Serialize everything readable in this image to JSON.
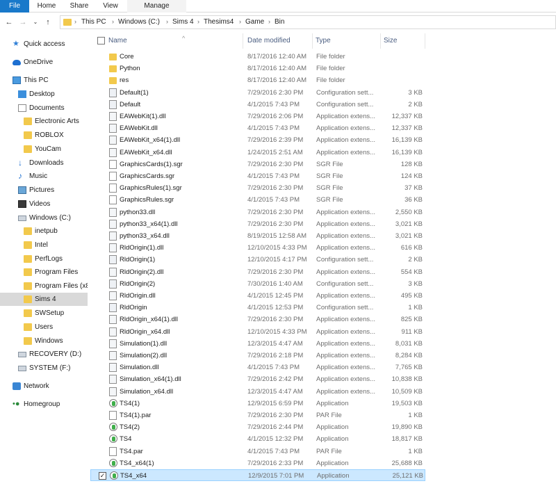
{
  "ribbon": {
    "tabs": [
      "File",
      "Home",
      "Share",
      "View",
      "Manage"
    ]
  },
  "address": {
    "crumbs": [
      "This PC",
      "Windows (C:)",
      "Sims 4",
      "Thesims4",
      "Game",
      "Bin"
    ]
  },
  "nav": {
    "items": [
      {
        "label": "Quick access",
        "icon": "star-icon"
      },
      {
        "label": "OneDrive",
        "icon": "cloud-icon"
      },
      {
        "label": "This PC",
        "icon": "pc-icon"
      },
      {
        "label": "Desktop",
        "icon": "desktop-icon"
      },
      {
        "label": "Documents",
        "icon": "documents-icon"
      },
      {
        "label": "Electronic Arts",
        "icon": "folder-icon"
      },
      {
        "label": "ROBLOX",
        "icon": "folder-icon"
      },
      {
        "label": "YouCam",
        "icon": "folder-icon"
      },
      {
        "label": "Downloads",
        "icon": "download-icon"
      },
      {
        "label": "Music",
        "icon": "music-icon"
      },
      {
        "label": "Pictures",
        "icon": "pictures-icon"
      },
      {
        "label": "Videos",
        "icon": "videos-icon"
      },
      {
        "label": "Windows (C:)",
        "icon": "drive-icon"
      },
      {
        "label": "inetpub",
        "icon": "folder-icon"
      },
      {
        "label": "Intel",
        "icon": "folder-icon"
      },
      {
        "label": "PerfLogs",
        "icon": "folder-icon"
      },
      {
        "label": "Program Files",
        "icon": "folder-icon"
      },
      {
        "label": "Program Files (x86",
        "icon": "folder-icon"
      },
      {
        "label": "Sims 4",
        "icon": "folder-icon"
      },
      {
        "label": "SWSetup",
        "icon": "folder-icon"
      },
      {
        "label": "Users",
        "icon": "folder-icon"
      },
      {
        "label": "Windows",
        "icon": "folder-icon"
      },
      {
        "label": "RECOVERY (D:)",
        "icon": "drive-icon"
      },
      {
        "label": "SYSTEM (F:)",
        "icon": "drive-icon"
      },
      {
        "label": "Network",
        "icon": "network-icon"
      },
      {
        "label": "Homegroup",
        "icon": "homegroup-icon"
      }
    ]
  },
  "columns": {
    "name": "Name",
    "date": "Date modified",
    "type": "Type",
    "size": "Size"
  },
  "files": [
    {
      "name": "Core",
      "date": "8/17/2016 12:40 AM",
      "type": "File folder",
      "size": "",
      "icon": "folder-icon"
    },
    {
      "name": "Python",
      "date": "8/17/2016 12:40 AM",
      "type": "File folder",
      "size": "",
      "icon": "folder-icon"
    },
    {
      "name": "res",
      "date": "8/17/2016 12:40 AM",
      "type": "File folder",
      "size": "",
      "icon": "folder-icon"
    },
    {
      "name": "Default(1)",
      "date": "7/29/2016 2:30 PM",
      "type": "Configuration sett...",
      "size": "3 KB",
      "icon": "config-file-icon"
    },
    {
      "name": "Default",
      "date": "4/1/2015 7:43 PM",
      "type": "Configuration sett...",
      "size": "2 KB",
      "icon": "config-file-icon"
    },
    {
      "name": "EAWebKit(1).dll",
      "date": "7/29/2016 2:06 PM",
      "type": "Application extens...",
      "size": "12,337 KB",
      "icon": "dll-file-icon"
    },
    {
      "name": "EAWebKit.dll",
      "date": "4/1/2015 7:43 PM",
      "type": "Application extens...",
      "size": "12,337 KB",
      "icon": "dll-file-icon"
    },
    {
      "name": "EAWebKit_x64(1).dll",
      "date": "7/29/2016 2:39 PM",
      "type": "Application extens...",
      "size": "16,139 KB",
      "icon": "dll-file-icon"
    },
    {
      "name": "EAWebKit_x64.dll",
      "date": "1/24/2015 2:51 AM",
      "type": "Application extens...",
      "size": "16,139 KB",
      "icon": "dll-file-icon"
    },
    {
      "name": "GraphicsCards(1).sgr",
      "date": "7/29/2016 2:30 PM",
      "type": "SGR File",
      "size": "128 KB",
      "icon": "file-icon"
    },
    {
      "name": "GraphicsCards.sgr",
      "date": "4/1/2015 7:43 PM",
      "type": "SGR File",
      "size": "124 KB",
      "icon": "file-icon"
    },
    {
      "name": "GraphicsRules(1).sgr",
      "date": "7/29/2016 2:30 PM",
      "type": "SGR File",
      "size": "37 KB",
      "icon": "file-icon"
    },
    {
      "name": "GraphicsRules.sgr",
      "date": "4/1/2015 7:43 PM",
      "type": "SGR File",
      "size": "36 KB",
      "icon": "file-icon"
    },
    {
      "name": "python33.dll",
      "date": "7/29/2016 2:30 PM",
      "type": "Application extens...",
      "size": "2,550 KB",
      "icon": "dll-file-icon"
    },
    {
      "name": "python33_x64(1).dll",
      "date": "7/29/2016 2:30 PM",
      "type": "Application extens...",
      "size": "3,021 KB",
      "icon": "dll-file-icon"
    },
    {
      "name": "python33_x64.dll",
      "date": "8/19/2015 12:58 AM",
      "type": "Application extens...",
      "size": "3,021 KB",
      "icon": "dll-file-icon"
    },
    {
      "name": "RldOrigin(1).dll",
      "date": "12/10/2015 4:33 PM",
      "type": "Application extens...",
      "size": "616 KB",
      "icon": "dll-file-icon"
    },
    {
      "name": "RldOrigin(1)",
      "date": "12/10/2015 4:17 PM",
      "type": "Configuration sett...",
      "size": "2 KB",
      "icon": "config-file-icon"
    },
    {
      "name": "RldOrigin(2).dll",
      "date": "7/29/2016 2:30 PM",
      "type": "Application extens...",
      "size": "554 KB",
      "icon": "dll-file-icon"
    },
    {
      "name": "RldOrigin(2)",
      "date": "7/30/2016 1:40 AM",
      "type": "Configuration sett...",
      "size": "3 KB",
      "icon": "config-file-icon"
    },
    {
      "name": "RldOrigin.dll",
      "date": "4/1/2015 12:45 PM",
      "type": "Application extens...",
      "size": "495 KB",
      "icon": "dll-file-icon"
    },
    {
      "name": "RldOrigin",
      "date": "4/1/2015 12:53 PM",
      "type": "Configuration sett...",
      "size": "1 KB",
      "icon": "config-file-icon"
    },
    {
      "name": "RldOrigin_x64(1).dll",
      "date": "7/29/2016 2:30 PM",
      "type": "Application extens...",
      "size": "825 KB",
      "icon": "dll-file-icon"
    },
    {
      "name": "RldOrigin_x64.dll",
      "date": "12/10/2015 4:33 PM",
      "type": "Application extens...",
      "size": "911 KB",
      "icon": "dll-file-icon"
    },
    {
      "name": "Simulation(1).dll",
      "date": "12/3/2015 4:47 AM",
      "type": "Application extens...",
      "size": "8,031 KB",
      "icon": "dll-file-icon"
    },
    {
      "name": "Simulation(2).dll",
      "date": "7/29/2016 2:18 PM",
      "type": "Application extens...",
      "size": "8,284 KB",
      "icon": "dll-file-icon"
    },
    {
      "name": "Simulation.dll",
      "date": "4/1/2015 7:43 PM",
      "type": "Application extens...",
      "size": "7,765 KB",
      "icon": "dll-file-icon"
    },
    {
      "name": "Simulation_x64(1).dll",
      "date": "7/29/2016 2:42 PM",
      "type": "Application extens...",
      "size": "10,838 KB",
      "icon": "dll-file-icon"
    },
    {
      "name": "Simulation_x64.dll",
      "date": "12/3/2015 4:47 AM",
      "type": "Application extens...",
      "size": "10,509 KB",
      "icon": "dll-file-icon"
    },
    {
      "name": "TS4(1)",
      "date": "12/9/2015 6:59 PM",
      "type": "Application",
      "size": "19,503 KB",
      "icon": "app-icon"
    },
    {
      "name": "TS4(1).par",
      "date": "7/29/2016 2:30 PM",
      "type": "PAR File",
      "size": "1 KB",
      "icon": "file-icon"
    },
    {
      "name": "TS4(2)",
      "date": "7/29/2016 2:44 PM",
      "type": "Application",
      "size": "19,890 KB",
      "icon": "app-icon"
    },
    {
      "name": "TS4",
      "date": "4/1/2015 12:32 PM",
      "type": "Application",
      "size": "18,817 KB",
      "icon": "app-icon"
    },
    {
      "name": "TS4.par",
      "date": "4/1/2015 7:43 PM",
      "type": "PAR File",
      "size": "1 KB",
      "icon": "file-icon"
    },
    {
      "name": "TS4_x64(1)",
      "date": "7/29/2016 2:33 PM",
      "type": "Application",
      "size": "25,688 KB",
      "icon": "app-icon"
    },
    {
      "name": "TS4_x64",
      "date": "12/9/2015 7:01 PM",
      "type": "Application",
      "size": "25,121 KB",
      "icon": "app-icon",
      "selected": true
    }
  ]
}
